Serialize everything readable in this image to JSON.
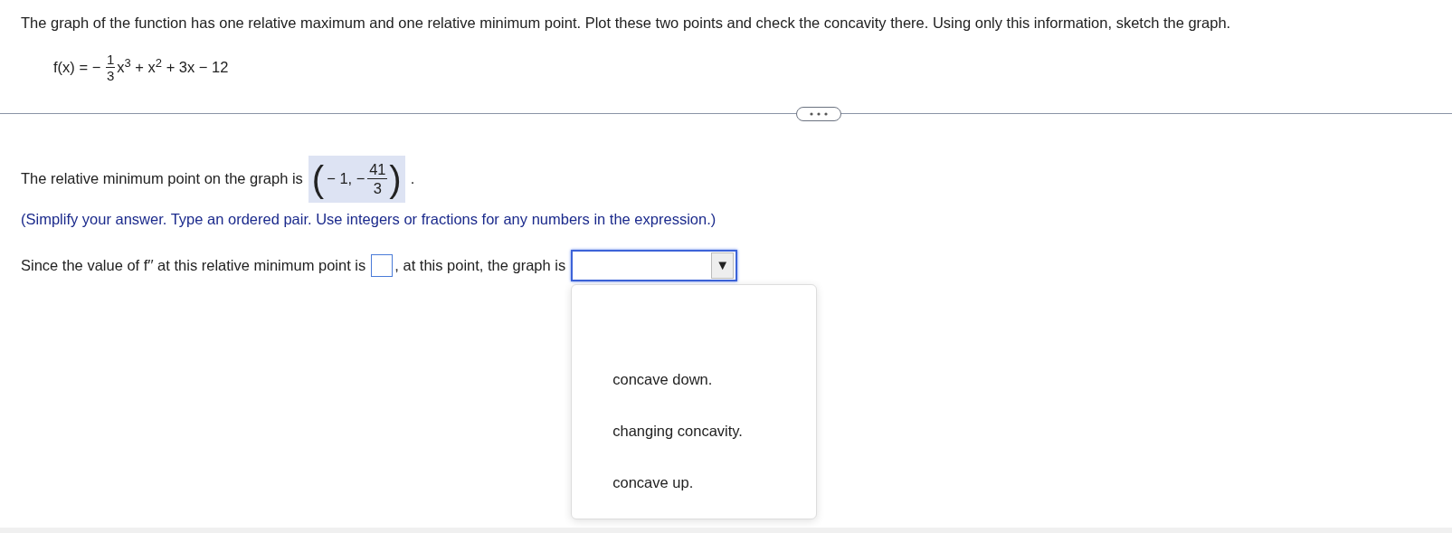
{
  "question": "The graph of the function has one relative maximum and one relative minimum point. Plot these two points and check the concavity there. Using only this information, sketch the graph.",
  "formula": {
    "lhs": "f(x) = −",
    "numerator": "1",
    "denominator": "3",
    "rest": "x$^{3}$ + x$^{2}$ + 3x − 12"
  },
  "answer_line": {
    "prefix": "The relative minimum point on the graph is",
    "open": "(",
    "value": "− 1, −",
    "numerator": "41",
    "denominator": "3",
    "close": ")",
    "suffix": "."
  },
  "instruction": "(Simplify your answer. Type an ordered pair. Use integers or fractions for any numbers in the expression.)",
  "concavity_line": {
    "prefix": "Since the value of f′′ at this relative minimum point is",
    "suffix": ", at this point, the graph is",
    "dropdown_arrow": "▼",
    "dropdown_expanded": true,
    "options": [
      {
        "label": "concave down.",
        "selected": false
      },
      {
        "label": "changing concavity.",
        "selected": false
      },
      {
        "label": "concave up.",
        "selected": false
      }
    ]
  }
}
